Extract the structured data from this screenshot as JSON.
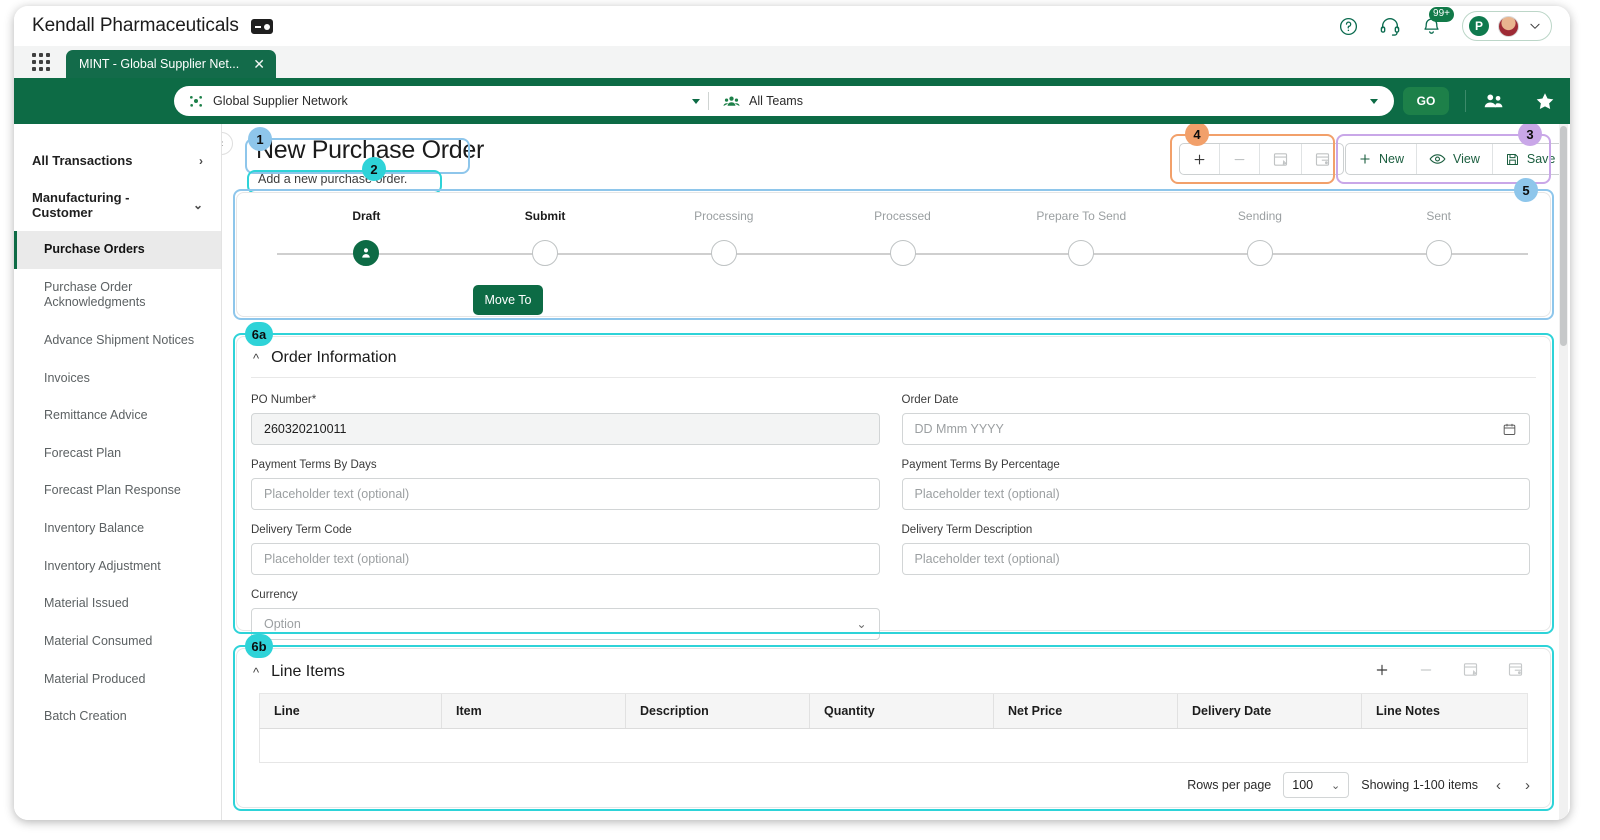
{
  "titlebar": {
    "app_title": "Kendall Pharmaceuticals",
    "logo_icon": "id-badge-icon",
    "help_icon": "question-circle-icon",
    "support_icon": "headset-icon",
    "notifications_icon": "bell-icon",
    "notifications_count": "99+",
    "brand_initial": "P",
    "avatar_icon": "user-avatar",
    "chevron_icon": "chevron-down-icon"
  },
  "tabstrip": {
    "apps_icon": "grid-apps-icon",
    "tabs": [
      {
        "label": "MINT - Global Supplier Net...",
        "close_icon": "close-icon"
      }
    ]
  },
  "greenbar": {
    "network_icon": "network-nodes-icon",
    "network_value": "Global Supplier Network",
    "teams_icon": "people-group-icon",
    "teams_value": "All Teams",
    "go_label": "GO",
    "people_icon": "people-icon",
    "star_icon": "star-icon"
  },
  "sidebar": {
    "collapse_icon": "chevron-left-icon",
    "groups": [
      {
        "label": "All Transactions",
        "chevron": "chevron-right-icon"
      },
      {
        "label": "Manufacturing - Customer",
        "chevron": "chevron-down-icon"
      }
    ],
    "items": [
      {
        "label": "Purchase Orders",
        "active": true
      },
      {
        "label": "Purchase Order Acknowledgments",
        "active": false
      },
      {
        "label": "Advance Shipment Notices",
        "active": false
      },
      {
        "label": "Invoices",
        "active": false
      },
      {
        "label": "Remittance Advice",
        "active": false
      },
      {
        "label": "Forecast Plan",
        "active": false
      },
      {
        "label": "Forecast Plan Response",
        "active": false
      },
      {
        "label": "Inventory Balance",
        "active": false
      },
      {
        "label": "Inventory Adjustment",
        "active": false
      },
      {
        "label": "Material Issued",
        "active": false
      },
      {
        "label": "Material Consumed",
        "active": false
      },
      {
        "label": "Material Produced",
        "active": false
      },
      {
        "label": "Batch Creation",
        "active": false
      }
    ]
  },
  "page": {
    "title": "New Purchase Order",
    "subtitle": "Add a new purchase order."
  },
  "record_toolbar": {
    "buttons": [
      {
        "label": "",
        "icon": "plus-icon",
        "state": "enabled"
      },
      {
        "label": "",
        "icon": "minus-icon",
        "state": "disabled"
      },
      {
        "label": "",
        "icon": "edit-form-icon",
        "state": "disabled"
      },
      {
        "label": "",
        "icon": "form-settings-icon",
        "state": "disabled"
      }
    ]
  },
  "action_toolbar": {
    "buttons": [
      {
        "label": "New",
        "icon": "plus-icon"
      },
      {
        "label": "View",
        "icon": "eye-icon"
      },
      {
        "label": "Save",
        "icon": "save-disk-icon"
      }
    ]
  },
  "stepper": {
    "steps": [
      {
        "label": "Draft",
        "state": "active",
        "icon": "user-person-icon"
      },
      {
        "label": "Submit",
        "state": "pending"
      },
      {
        "label": "Processing",
        "state": "pending"
      },
      {
        "label": "Processed",
        "state": "pending"
      },
      {
        "label": "Prepare To Send",
        "state": "pending"
      },
      {
        "label": "Sending",
        "state": "pending"
      },
      {
        "label": "Sent",
        "state": "pending"
      }
    ],
    "move_to_label": "Move To"
  },
  "order_information": {
    "title": "Order Information",
    "collapse_icon": "chevron-up-icon",
    "fields": [
      {
        "label": "PO Number*",
        "value": "260320210011",
        "placeholder": "",
        "filled": true,
        "type": "text"
      },
      {
        "label": "Order Date",
        "value": "",
        "placeholder": "DD Mmm YYYY",
        "filled": false,
        "type": "date"
      },
      {
        "label": "Payment Terms By Days",
        "value": "",
        "placeholder": "Placeholder text (optional)",
        "filled": false,
        "type": "text"
      },
      {
        "label": "Payment Terms By Percentage",
        "value": "",
        "placeholder": "Placeholder text (optional)",
        "filled": false,
        "type": "text"
      },
      {
        "label": "Delivery Term Code",
        "value": "",
        "placeholder": "Placeholder text (optional)",
        "filled": false,
        "type": "text"
      },
      {
        "label": "Delivery Term Description",
        "value": "",
        "placeholder": "Placeholder text (optional)",
        "filled": false,
        "type": "text"
      },
      {
        "label": "Currency",
        "value": "",
        "placeholder": "Option",
        "filled": false,
        "type": "select"
      }
    ]
  },
  "line_items": {
    "title": "Line Items",
    "collapse_icon": "chevron-up-icon",
    "toolbar": [
      {
        "icon": "plus-icon",
        "state": "enabled"
      },
      {
        "icon": "minus-icon",
        "state": "disabled"
      },
      {
        "icon": "edit-form-icon",
        "state": "disabled"
      },
      {
        "icon": "form-settings-icon",
        "state": "disabled"
      }
    ],
    "columns": [
      "Line",
      "Item",
      "Description",
      "Quantity",
      "Net Price",
      "Delivery Date",
      "Line Notes"
    ],
    "rows": [],
    "footer": {
      "rows_per_page_label": "Rows per page",
      "rows_per_page_value": "100",
      "showing_label": "Showing 1-100 items",
      "prev_icon": "chevron-left-icon",
      "next_icon": "chevron-right-icon"
    }
  },
  "annotations": [
    {
      "id": "1",
      "label": "1",
      "color": "#8EC6EB",
      "target": "page-title"
    },
    {
      "id": "2",
      "label": "2",
      "color": "#2ED3D8",
      "target": "page-subtitle"
    },
    {
      "id": "3",
      "label": "3",
      "color": "#C9A7E8",
      "target": "action-toolbar"
    },
    {
      "id": "4",
      "label": "4",
      "color": "#F2A06A",
      "target": "record-toolbar"
    },
    {
      "id": "5",
      "label": "5",
      "color": "#8EC6EB",
      "target": "stepper"
    },
    {
      "id": "6a",
      "label": "6a",
      "color": "#2ED3D8",
      "target": "order-information"
    },
    {
      "id": "6b",
      "label": "6b",
      "color": "#2ED3D8",
      "target": "line-items"
    }
  ]
}
